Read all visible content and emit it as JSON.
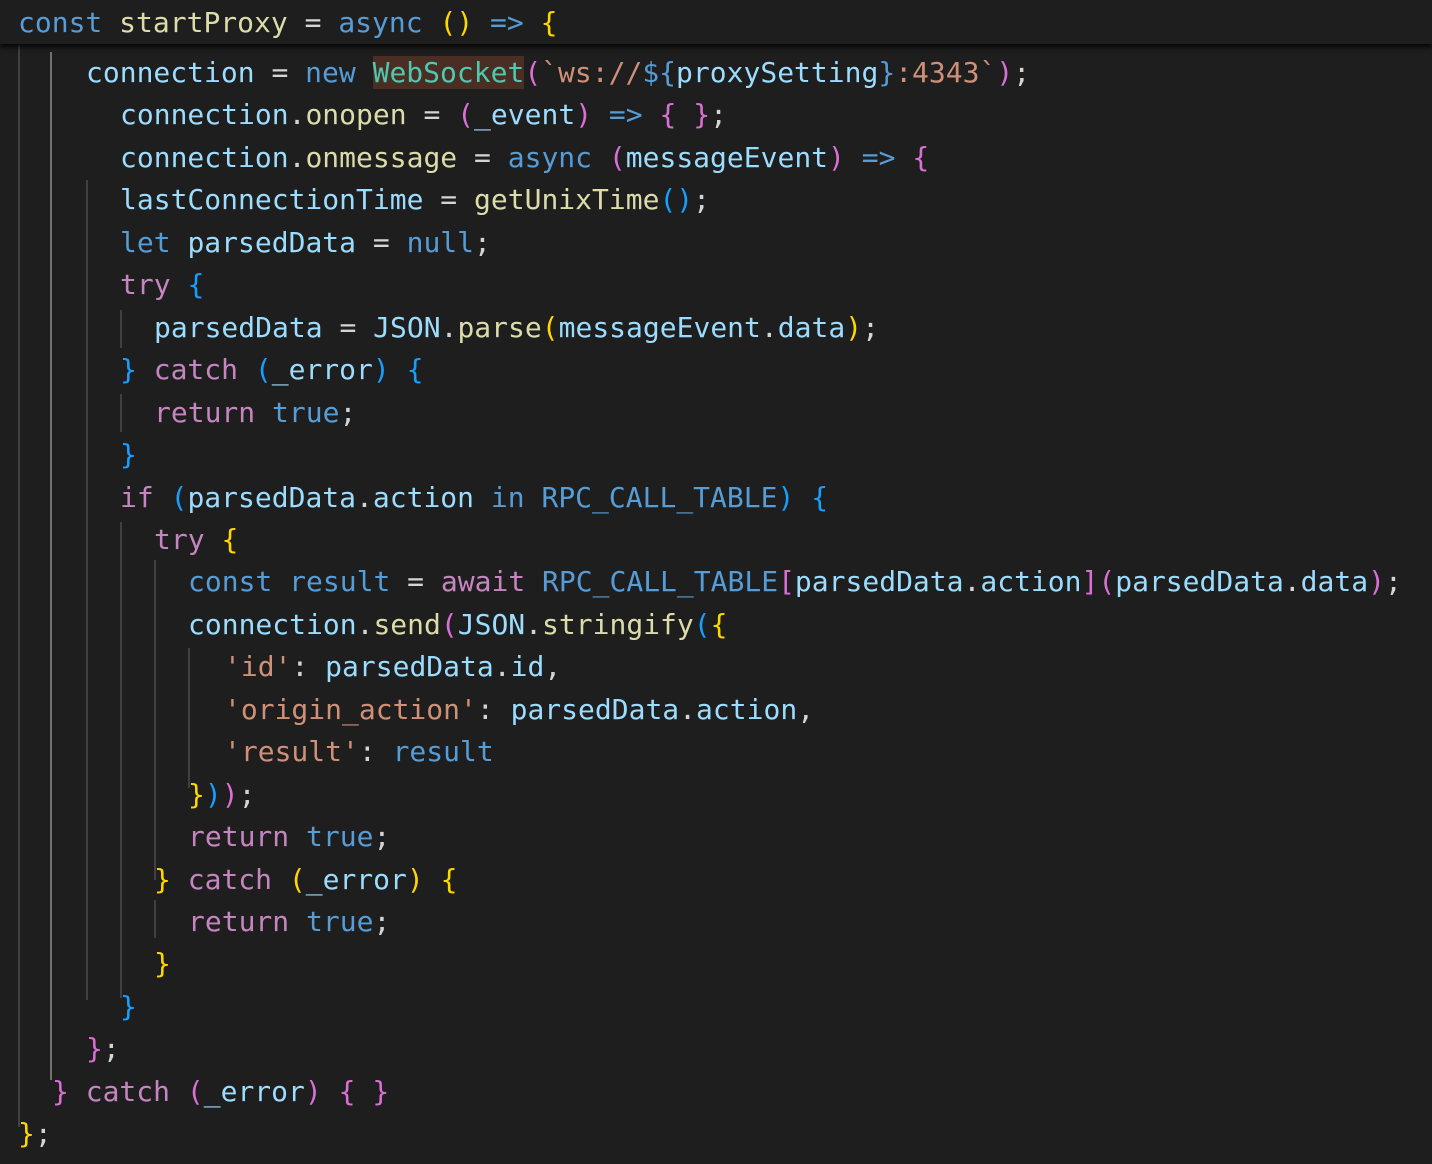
{
  "editor": {
    "sticky_line": [
      {
        "t": "const",
        "c": "kw-b"
      },
      {
        "t": " "
      },
      {
        "t": "startProxy",
        "c": "fn"
      },
      {
        "t": " "
      },
      {
        "t": "=",
        "c": "op"
      },
      {
        "t": " "
      },
      {
        "t": "async",
        "c": "kw-b"
      },
      {
        "t": " "
      },
      {
        "t": "()",
        "c": "b1"
      },
      {
        "t": " "
      },
      {
        "t": "=>",
        "c": "kw-b"
      },
      {
        "t": " "
      },
      {
        "t": "{",
        "c": "b1"
      }
    ],
    "lines": [
      [
        {
          "t": "connection",
          "c": "var"
        },
        {
          "t": " "
        },
        {
          "t": "=",
          "c": "op"
        },
        {
          "t": " "
        },
        {
          "t": "new",
          "c": "kw-b"
        },
        {
          "t": " "
        },
        {
          "t": "WebSocket",
          "c": "cls hl-bg"
        },
        {
          "t": "(",
          "c": "b2"
        },
        {
          "t": "`ws://",
          "c": "str"
        },
        {
          "t": "${",
          "c": "kw-b"
        },
        {
          "t": "proxySetting",
          "c": "var"
        },
        {
          "t": "}",
          "c": "kw-b"
        },
        {
          "t": ":4343`",
          "c": "str"
        },
        {
          "t": ")",
          "c": "b2"
        },
        {
          "t": ";",
          "c": "pun"
        }
      ],
      [
        {
          "t": "connection",
          "c": "var"
        },
        {
          "t": ".",
          "c": "pun"
        },
        {
          "t": "onopen",
          "c": "fn"
        },
        {
          "t": " "
        },
        {
          "t": "=",
          "c": "op"
        },
        {
          "t": " "
        },
        {
          "t": "(",
          "c": "b2"
        },
        {
          "t": "_event",
          "c": "var"
        },
        {
          "t": ")",
          "c": "b2"
        },
        {
          "t": " "
        },
        {
          "t": "=>",
          "c": "kw-b"
        },
        {
          "t": " "
        },
        {
          "t": "{",
          "c": "b2"
        },
        {
          "t": " "
        },
        {
          "t": "}",
          "c": "b2"
        },
        {
          "t": ";",
          "c": "pun"
        }
      ],
      [
        {
          "t": "connection",
          "c": "var"
        },
        {
          "t": ".",
          "c": "pun"
        },
        {
          "t": "onmessage",
          "c": "fn"
        },
        {
          "t": " "
        },
        {
          "t": "=",
          "c": "op"
        },
        {
          "t": " "
        },
        {
          "t": "async",
          "c": "kw-b"
        },
        {
          "t": " "
        },
        {
          "t": "(",
          "c": "b2"
        },
        {
          "t": "messageEvent",
          "c": "var"
        },
        {
          "t": ")",
          "c": "b2"
        },
        {
          "t": " "
        },
        {
          "t": "=>",
          "c": "kw-b"
        },
        {
          "t": " "
        },
        {
          "t": "{",
          "c": "b2"
        }
      ],
      [
        {
          "t": "lastConnectionTime",
          "c": "var"
        },
        {
          "t": " "
        },
        {
          "t": "=",
          "c": "op"
        },
        {
          "t": " "
        },
        {
          "t": "getUnixTime",
          "c": "fn"
        },
        {
          "t": "()",
          "c": "b3"
        },
        {
          "t": ";",
          "c": "pun"
        }
      ],
      [
        {
          "t": "let",
          "c": "kw-b"
        },
        {
          "t": " "
        },
        {
          "t": "parsedData",
          "c": "var"
        },
        {
          "t": " "
        },
        {
          "t": "=",
          "c": "op"
        },
        {
          "t": " "
        },
        {
          "t": "null",
          "c": "kw-b"
        },
        {
          "t": ";",
          "c": "pun"
        }
      ],
      [
        {
          "t": "try",
          "c": "kw-p"
        },
        {
          "t": " "
        },
        {
          "t": "{",
          "c": "b3"
        }
      ],
      [
        {
          "t": "parsedData",
          "c": "var"
        },
        {
          "t": " "
        },
        {
          "t": "=",
          "c": "op"
        },
        {
          "t": " "
        },
        {
          "t": "JSON",
          "c": "var"
        },
        {
          "t": ".",
          "c": "pun"
        },
        {
          "t": "parse",
          "c": "fn"
        },
        {
          "t": "(",
          "c": "b1"
        },
        {
          "t": "messageEvent",
          "c": "var"
        },
        {
          "t": ".",
          "c": "pun"
        },
        {
          "t": "data",
          "c": "var"
        },
        {
          "t": ")",
          "c": "b1"
        },
        {
          "t": ";",
          "c": "pun"
        }
      ],
      [
        {
          "t": "}",
          "c": "b3"
        },
        {
          "t": " "
        },
        {
          "t": "catch",
          "c": "kw-p"
        },
        {
          "t": " "
        },
        {
          "t": "(",
          "c": "b3"
        },
        {
          "t": "_error",
          "c": "var"
        },
        {
          "t": ")",
          "c": "b3"
        },
        {
          "t": " "
        },
        {
          "t": "{",
          "c": "b3"
        }
      ],
      [
        {
          "t": "return",
          "c": "kw-p"
        },
        {
          "t": " "
        },
        {
          "t": "true",
          "c": "kw-b"
        },
        {
          "t": ";",
          "c": "pun"
        }
      ],
      [
        {
          "t": "}",
          "c": "b3"
        }
      ],
      [
        {
          "t": "if",
          "c": "kw-p"
        },
        {
          "t": " "
        },
        {
          "t": "(",
          "c": "b3"
        },
        {
          "t": "parsedData",
          "c": "var"
        },
        {
          "t": ".",
          "c": "pun"
        },
        {
          "t": "action",
          "c": "var"
        },
        {
          "t": " "
        },
        {
          "t": "in",
          "c": "kw-b"
        },
        {
          "t": " "
        },
        {
          "t": "RPC_CALL_TABLE",
          "c": "kw-b"
        },
        {
          "t": ")",
          "c": "b3"
        },
        {
          "t": " "
        },
        {
          "t": "{",
          "c": "b3"
        }
      ],
      [
        {
          "t": "try",
          "c": "kw-p"
        },
        {
          "t": " "
        },
        {
          "t": "{",
          "c": "b1"
        }
      ],
      [
        {
          "t": "const",
          "c": "kw-b"
        },
        {
          "t": " "
        },
        {
          "t": "result",
          "c": "kw-b"
        },
        {
          "t": " "
        },
        {
          "t": "=",
          "c": "op"
        },
        {
          "t": " "
        },
        {
          "t": "await",
          "c": "kw-p"
        },
        {
          "t": " "
        },
        {
          "t": "RPC_CALL_TABLE",
          "c": "kw-b"
        },
        {
          "t": "[",
          "c": "b2"
        },
        {
          "t": "parsedData",
          "c": "var"
        },
        {
          "t": ".",
          "c": "pun"
        },
        {
          "t": "action",
          "c": "var"
        },
        {
          "t": "]",
          "c": "b2"
        },
        {
          "t": "(",
          "c": "b2"
        },
        {
          "t": "parsedData",
          "c": "var"
        },
        {
          "t": ".",
          "c": "pun"
        },
        {
          "t": "data",
          "c": "var"
        },
        {
          "t": ")",
          "c": "b2"
        },
        {
          "t": ";",
          "c": "pun"
        }
      ],
      [
        {
          "t": "connection",
          "c": "var"
        },
        {
          "t": ".",
          "c": "pun"
        },
        {
          "t": "send",
          "c": "fn"
        },
        {
          "t": "(",
          "c": "b2"
        },
        {
          "t": "JSON",
          "c": "var"
        },
        {
          "t": ".",
          "c": "pun"
        },
        {
          "t": "stringify",
          "c": "fn"
        },
        {
          "t": "(",
          "c": "b3"
        },
        {
          "t": "{",
          "c": "b1"
        }
      ],
      [
        {
          "t": "'id'",
          "c": "str"
        },
        {
          "t": ":",
          "c": "pun"
        },
        {
          "t": " "
        },
        {
          "t": "parsedData",
          "c": "var"
        },
        {
          "t": ".",
          "c": "pun"
        },
        {
          "t": "id",
          "c": "var"
        },
        {
          "t": ",",
          "c": "pun"
        }
      ],
      [
        {
          "t": "'origin_action'",
          "c": "str"
        },
        {
          "t": ":",
          "c": "pun"
        },
        {
          "t": " "
        },
        {
          "t": "parsedData",
          "c": "var"
        },
        {
          "t": ".",
          "c": "pun"
        },
        {
          "t": "action",
          "c": "var"
        },
        {
          "t": ",",
          "c": "pun"
        }
      ],
      [
        {
          "t": "'result'",
          "c": "str"
        },
        {
          "t": ":",
          "c": "pun"
        },
        {
          "t": " "
        },
        {
          "t": "result",
          "c": "kw-b"
        }
      ],
      [
        {
          "t": "}",
          "c": "b1"
        },
        {
          "t": ")",
          "c": "b3"
        },
        {
          "t": ")",
          "c": "b2"
        },
        {
          "t": ";",
          "c": "pun"
        }
      ],
      [
        {
          "t": "return",
          "c": "kw-p"
        },
        {
          "t": " "
        },
        {
          "t": "true",
          "c": "kw-b"
        },
        {
          "t": ";",
          "c": "pun"
        }
      ],
      [
        {
          "t": "}",
          "c": "b1"
        },
        {
          "t": " "
        },
        {
          "t": "catch",
          "c": "kw-p"
        },
        {
          "t": " "
        },
        {
          "t": "(",
          "c": "b1"
        },
        {
          "t": "_error",
          "c": "var"
        },
        {
          "t": ")",
          "c": "b1"
        },
        {
          "t": " "
        },
        {
          "t": "{",
          "c": "b1"
        }
      ],
      [
        {
          "t": "return",
          "c": "kw-p"
        },
        {
          "t": " "
        },
        {
          "t": "true",
          "c": "kw-b"
        },
        {
          "t": ";",
          "c": "pun"
        }
      ],
      [
        {
          "t": "}",
          "c": "b1"
        }
      ],
      [
        {
          "t": "}",
          "c": "b3"
        }
      ],
      [
        {
          "t": "}",
          "c": "b2"
        },
        {
          "t": ";",
          "c": "pun"
        }
      ],
      [
        {
          "t": "}",
          "c": "b2"
        },
        {
          "t": " "
        },
        {
          "t": "catch",
          "c": "kw-p"
        },
        {
          "t": " "
        },
        {
          "t": "(",
          "c": "b2"
        },
        {
          "t": "_error",
          "c": "var"
        },
        {
          "t": ")",
          "c": "b2"
        },
        {
          "t": " "
        },
        {
          "t": "{",
          "c": "b2"
        },
        {
          "t": " "
        },
        {
          "t": "}",
          "c": "b2"
        }
      ],
      [
        {
          "t": "}",
          "c": "b1"
        },
        {
          "t": ";",
          "c": "pun"
        }
      ]
    ]
  }
}
